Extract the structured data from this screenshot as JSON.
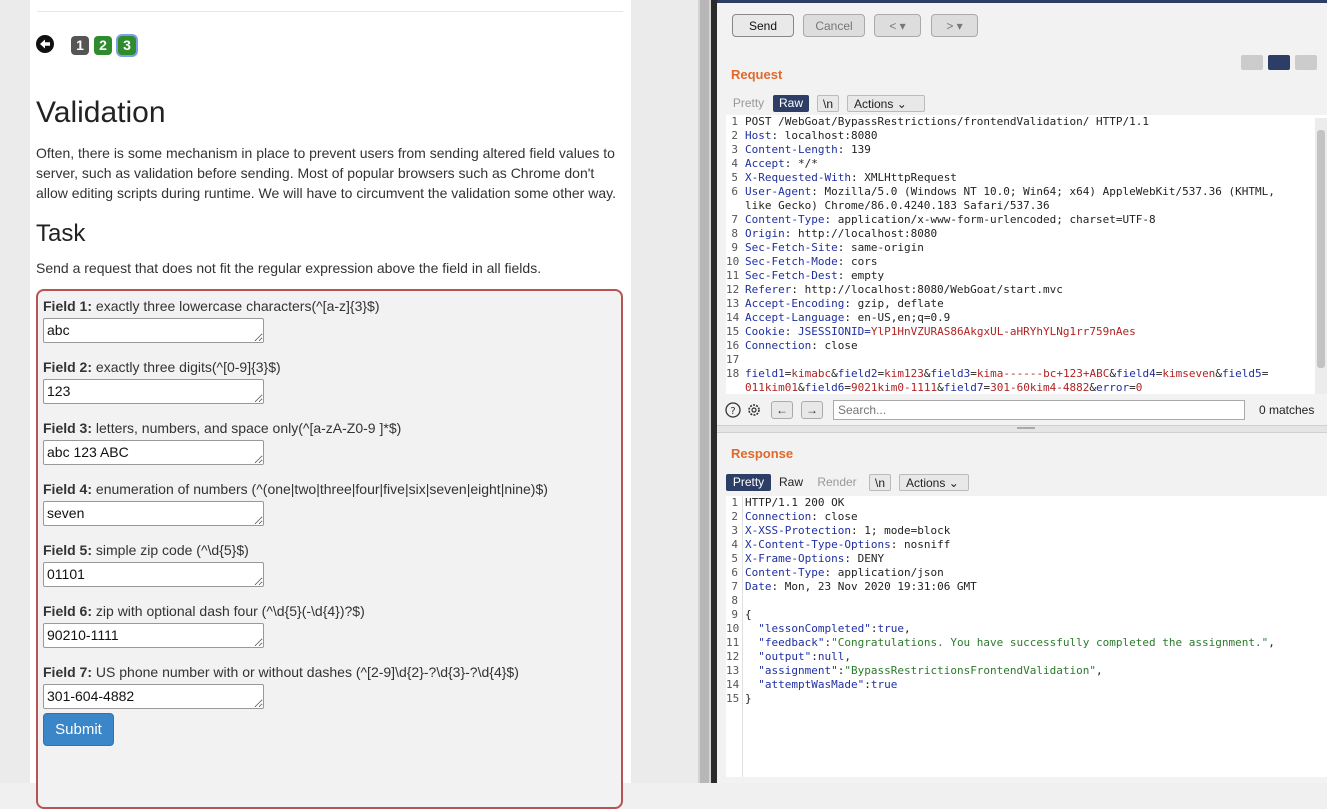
{
  "left": {
    "pagination": [
      "1",
      "2",
      "3"
    ],
    "title": "Validation",
    "intro": "Often, there is some mechanism in place to prevent users from sending altered field values to server, such as validation before sending. Most of popular browsers such as Chrome don't allow editing scripts during runtime. We will have to circumvent the validation some other way.",
    "task_heading": "Task",
    "task_text": "Send a request that does not fit the regular expression above the field in all fields.",
    "fields": [
      {
        "label": "Field 1:",
        "desc": " exactly three lowercase characters(^[a-z]{3}$)",
        "value": "abc"
      },
      {
        "label": "Field 2:",
        "desc": " exactly three digits(^[0-9]{3}$)",
        "value": "123"
      },
      {
        "label": "Field 3:",
        "desc": " letters, numbers, and space only(^[a-zA-Z0-9 ]*$)",
        "value": "abc 123 ABC"
      },
      {
        "label": "Field 4:",
        "desc": " enumeration of numbers (^(one|two|three|four|five|six|seven|eight|nine)$)",
        "value": "seven"
      },
      {
        "label": "Field 5:",
        "desc": " simple zip code (^\\d{5}$)",
        "value": "01101"
      },
      {
        "label": "Field 6:",
        "desc": " zip with optional dash four (^\\d{5}(-\\d{4})?$)",
        "value": "90210-1111"
      },
      {
        "label": "Field 7:",
        "desc": " US phone number with or without dashes (^[2-9]\\d{2}-?\\d{3}-?\\d{4}$)",
        "value": "301-604-4882"
      }
    ],
    "submit_label": "Submit"
  },
  "toolbar": {
    "send": "Send",
    "cancel": "Cancel",
    "prev": "< ▾",
    "next": "> ▾"
  },
  "request": {
    "title": "Request",
    "tabs": [
      "Pretty",
      "Raw",
      "\\n",
      "Actions"
    ],
    "lines": [
      {
        "n": "1",
        "name": "",
        "sep": "",
        "value": "POST /WebGoat/BypassRestrictions/frontendValidation/ HTTP/1.1"
      },
      {
        "n": "2",
        "name": "Host",
        "sep": ": ",
        "value": "localhost:8080"
      },
      {
        "n": "3",
        "name": "Content-Length",
        "sep": ": ",
        "value": "139"
      },
      {
        "n": "4",
        "name": "Accept",
        "sep": ": ",
        "value": "*/*"
      },
      {
        "n": "5",
        "name": "X-Requested-With",
        "sep": ": ",
        "value": "XMLHttpRequest"
      },
      {
        "n": "6",
        "name": "User-Agent",
        "sep": ": ",
        "value": "Mozilla/5.0 (Windows NT 10.0; Win64; x64) AppleWebKit/537.36 (KHTML,"
      },
      {
        "n": "",
        "name": "",
        "sep": "",
        "value": "like Gecko) Chrome/86.0.4240.183 Safari/537.36"
      },
      {
        "n": "7",
        "name": "Content-Type",
        "sep": ": ",
        "value": "application/x-www-form-urlencoded; charset=UTF-8"
      },
      {
        "n": "8",
        "name": "Origin",
        "sep": ": ",
        "value": "http://localhost:8080"
      },
      {
        "n": "9",
        "name": "Sec-Fetch-Site",
        "sep": ": ",
        "value": "same-origin"
      },
      {
        "n": "10",
        "name": "Sec-Fetch-Mode",
        "sep": ": ",
        "value": "cors"
      },
      {
        "n": "11",
        "name": "Sec-Fetch-Dest",
        "sep": ": ",
        "value": "empty"
      },
      {
        "n": "12",
        "name": "Referer",
        "sep": ": ",
        "value": "http://localhost:8080/WebGoat/start.mvc"
      },
      {
        "n": "13",
        "name": "Accept-Encoding",
        "sep": ": ",
        "value": "gzip, deflate"
      },
      {
        "n": "14",
        "name": "Accept-Language",
        "sep": ": ",
        "value": "en-US,en;q=0.9"
      },
      {
        "n": "15",
        "name": "Cookie",
        "sep": ": ",
        "value": "JSESSIONID=YlP1HnVZURAS86AkgxUL-aHRYhYLNg1rr759nAes"
      },
      {
        "n": "16",
        "name": "Connection",
        "sep": ": ",
        "value": "close"
      },
      {
        "n": "17",
        "name": "",
        "sep": "",
        "value": ""
      }
    ],
    "body_line_no": "18",
    "body_line1": [
      [
        "field1",
        "kimabc"
      ],
      [
        "field2",
        "kim123"
      ],
      [
        "field3",
        "kima------bc+123+ABC"
      ],
      [
        "field4",
        "kimseven"
      ],
      [
        "field5",
        ""
      ]
    ],
    "body_line2_start": "011kim01",
    "body_line2": [
      [
        "field6",
        "9021kim0-1111"
      ],
      [
        "field7",
        "301-60kim4-4882"
      ],
      [
        "error",
        "0"
      ]
    ],
    "search_placeholder": "Search...",
    "matches": "0 matches"
  },
  "response": {
    "title": "Response",
    "tabs": [
      "Pretty",
      "Raw",
      "Render",
      "\\n",
      "Actions"
    ],
    "header_lines": [
      {
        "n": "1",
        "name": "",
        "sep": "",
        "value": "HTTP/1.1 200 OK"
      },
      {
        "n": "2",
        "name": "Connection",
        "sep": ": ",
        "value": "close"
      },
      {
        "n": "3",
        "name": "X-XSS-Protection",
        "sep": ": ",
        "value": "1; mode=block"
      },
      {
        "n": "4",
        "name": "X-Content-Type-Options",
        "sep": ": ",
        "value": "nosniff"
      },
      {
        "n": "5",
        "name": "X-Frame-Options",
        "sep": ": ",
        "value": "DENY"
      },
      {
        "n": "6",
        "name": "Content-Type",
        "sep": ": ",
        "value": "application/json"
      },
      {
        "n": "7",
        "name": "Date",
        "sep": ": ",
        "value": "Mon, 23 Nov 2020 19:31:06 GMT"
      },
      {
        "n": "8",
        "name": "",
        "sep": "",
        "value": ""
      },
      {
        "n": "9",
        "name": "",
        "sep": "",
        "value": "{"
      }
    ],
    "json_lines": [
      {
        "n": "10",
        "key": "\"lessonCompleted\"",
        "val": "true",
        "kind": "lit",
        "comma": ","
      },
      {
        "n": "11",
        "key": "\"feedback\"",
        "val": "\"Congratulations. You have successfully completed the assignment.\"",
        "kind": "str",
        "comma": ","
      },
      {
        "n": "12",
        "key": "\"output\"",
        "val": "null",
        "kind": "lit",
        "comma": ","
      },
      {
        "n": "13",
        "key": "\"assignment\"",
        "val": "\"BypassRestrictionsFrontendValidation\"",
        "kind": "str",
        "comma": ","
      },
      {
        "n": "14",
        "key": "\"attemptWasMade\"",
        "val": "true",
        "kind": "lit",
        "comma": ""
      }
    ],
    "close_line": {
      "n": "15",
      "value": "}"
    }
  },
  "colors": {
    "accent_orange": "#e06a2c",
    "tab_active": "#2c3e66",
    "form_border": "#b65353",
    "submit": "#3a86c8"
  }
}
